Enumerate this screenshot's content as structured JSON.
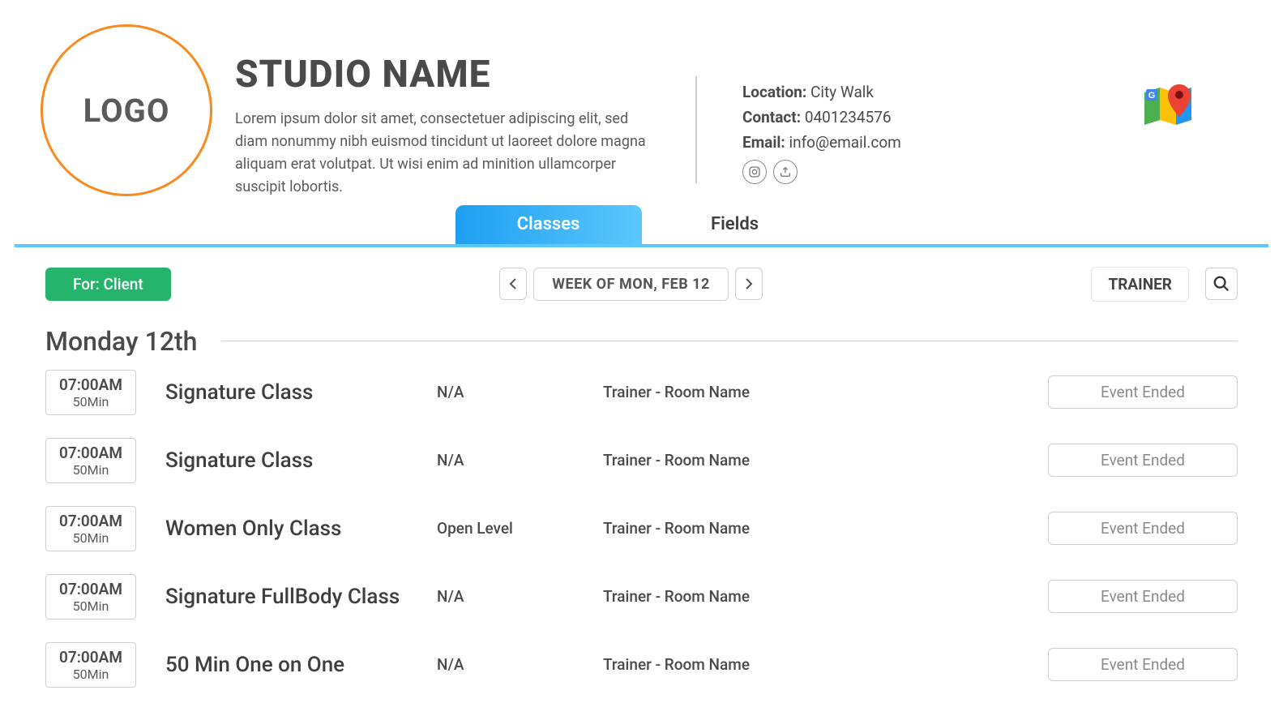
{
  "header": {
    "logo_text": "LOGO",
    "studio_name": "STUDIO NAME",
    "description": "Lorem ipsum dolor sit amet, consectetuer adipiscing elit, sed diam nonummy nibh euismod tincidunt ut laoreet dolore magna aliquam erat volutpat. Ut wisi enim ad minition ullamcorper suscipit lobortis.",
    "location_label": "Location:",
    "location_value": "City Walk",
    "contact_label": "Contact:",
    "contact_value": "0401234576",
    "email_label": "Email:",
    "email_value": "info@email.com"
  },
  "tabs": {
    "classes": "Classes",
    "fields": "Fields"
  },
  "controls": {
    "for_client": "For: Client",
    "week_label": "WEEK OF MON, FEB 12",
    "trainer": "TRAINER"
  },
  "day": {
    "title": "Monday 12th"
  },
  "rows": [
    {
      "time": "07:00AM",
      "duration": "50Min",
      "name": "Signature Class",
      "level": "N/A",
      "trainer_room": "Trainer - Room Name",
      "status": "Event Ended"
    },
    {
      "time": "07:00AM",
      "duration": "50Min",
      "name": "Signature Class",
      "level": "N/A",
      "trainer_room": "Trainer - Room Name",
      "status": "Event Ended"
    },
    {
      "time": "07:00AM",
      "duration": "50Min",
      "name": "Women Only Class",
      "level": "Open Level",
      "trainer_room": "Trainer - Room Name",
      "status": "Event Ended"
    },
    {
      "time": "07:00AM",
      "duration": "50Min",
      "name": "Signature FullBody Class",
      "level": "N/A",
      "trainer_room": "Trainer - Room Name",
      "status": "Event Ended"
    },
    {
      "time": "07:00AM",
      "duration": "50Min",
      "name": "50 Min One on One",
      "level": "N/A",
      "trainer_room": "Trainer - Room Name",
      "status": "Event Ended"
    }
  ]
}
